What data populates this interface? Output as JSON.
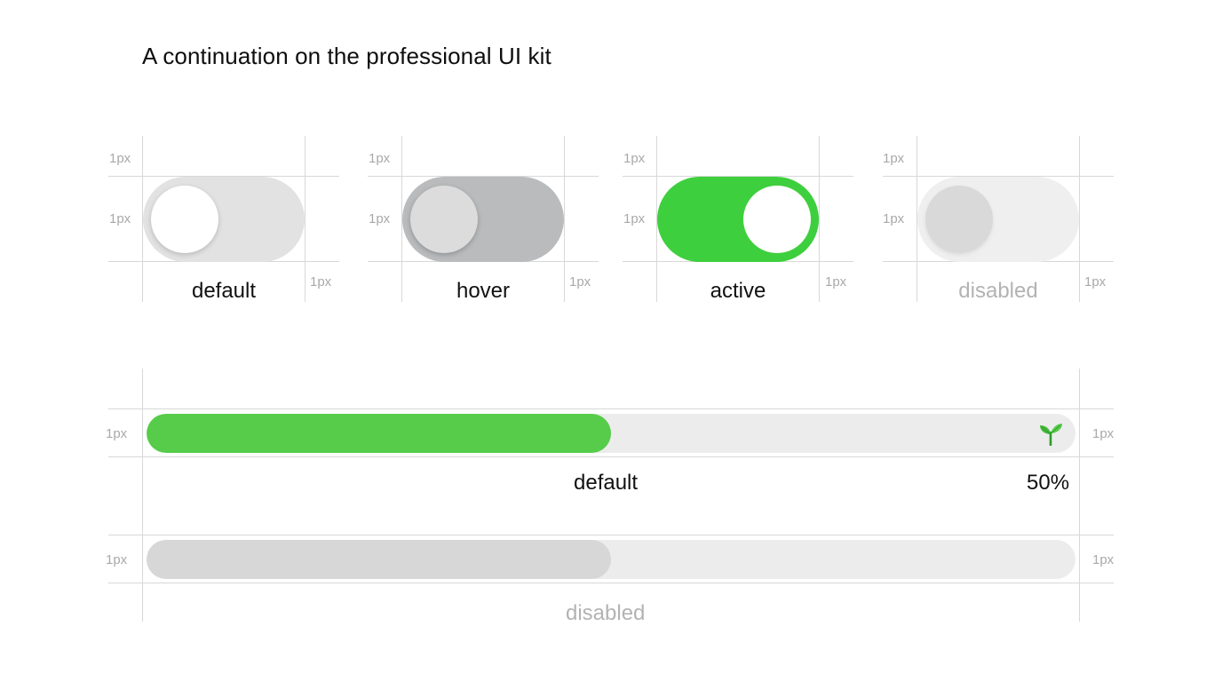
{
  "page": {
    "title": "A continuation on the professional UI kit"
  },
  "spacing_note": "1px",
  "colors": {
    "active_green": "#3ecf3e",
    "progress_green": "#56cc4a",
    "default_track": "#e2e2e2",
    "hover_track": "#b9bbbd",
    "disabled_track": "#efefef",
    "disabled_text": "#b3b3b3",
    "guide_line": "#d8d8d8"
  },
  "toggles": [
    {
      "state": "default",
      "label": "default",
      "on": false
    },
    {
      "state": "hover",
      "label": "hover",
      "on": false
    },
    {
      "state": "active",
      "label": "active",
      "on": true
    },
    {
      "state": "disabled",
      "label": "disabled",
      "on": false
    }
  ],
  "progress_bars": [
    {
      "state": "default",
      "label": "default",
      "value_percent": 50,
      "value_text": "50%",
      "icon": "sprout-icon"
    },
    {
      "state": "disabled",
      "label": "disabled",
      "value_percent": 50
    }
  ]
}
